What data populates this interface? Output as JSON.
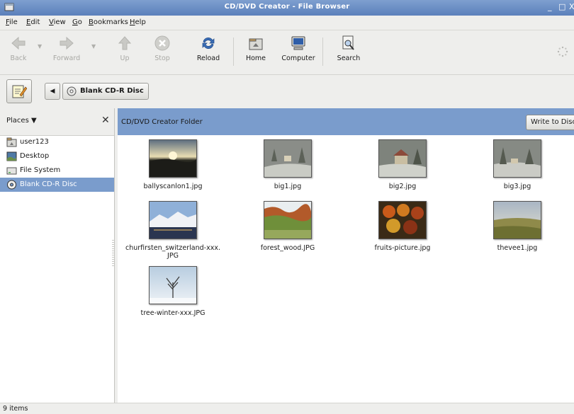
{
  "window": {
    "title": "CD/DVD Creator - File Browser",
    "controls": [
      "_",
      "□",
      "X"
    ]
  },
  "menu": [
    {
      "label": "File",
      "mnemonic": "F",
      "rest": "ile"
    },
    {
      "label": "Edit",
      "mnemonic": "E",
      "rest": "dit"
    },
    {
      "label": "View",
      "mnemonic": "V",
      "rest": "iew"
    },
    {
      "label": "Go",
      "mnemonic": "G",
      "rest": "o"
    },
    {
      "label": "Bookmarks",
      "mnemonic": "B",
      "rest": "ookmarks"
    },
    {
      "label": "Help",
      "mnemonic": "H",
      "rest": "elp"
    }
  ],
  "toolbar": {
    "back": "Back",
    "forward": "Forward",
    "up": "Up",
    "stop": "Stop",
    "reload": "Reload",
    "home": "Home",
    "computer": "Computer",
    "search": "Search"
  },
  "location": {
    "crumb": "Blank CD-R Disc"
  },
  "sidebar": {
    "title": "Places",
    "items": [
      {
        "label": "user123",
        "icon": "home-folder-icon"
      },
      {
        "label": "Desktop",
        "icon": "desktop-icon"
      },
      {
        "label": "File System",
        "icon": "drive-icon"
      },
      {
        "label": "Blank CD-R Disc",
        "icon": "cd-icon",
        "selected": true
      }
    ]
  },
  "content": {
    "banner_title": "CD/DVD Creator Folder",
    "write_button": "Write to Disc",
    "files": [
      {
        "name": "ballyscanlon1.jpg"
      },
      {
        "name": "big1.jpg"
      },
      {
        "name": "big2.jpg"
      },
      {
        "name": "big3.jpg"
      },
      {
        "name": "churfirsten_switzerland-xxx.\nJPG"
      },
      {
        "name": "forest_wood.JPG"
      },
      {
        "name": "fruits-picture.jpg"
      },
      {
        "name": "thevee1.jpg"
      },
      {
        "name": "tree-winter-xxx.JPG"
      }
    ]
  },
  "status": {
    "text": "9 items"
  }
}
